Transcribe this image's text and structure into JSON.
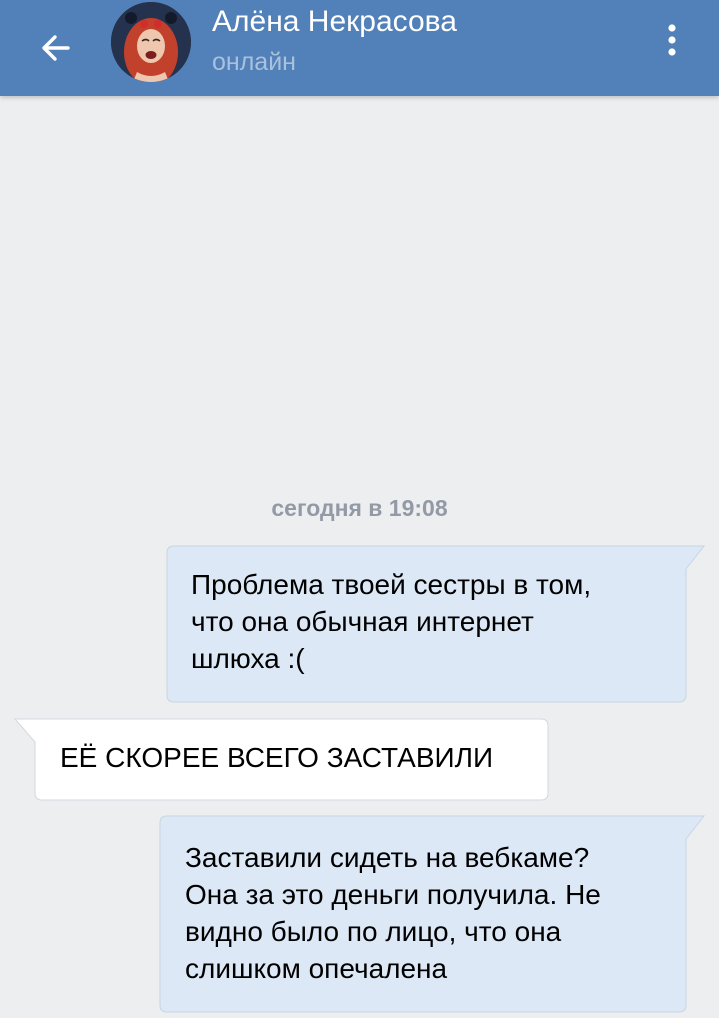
{
  "header": {
    "title": "Алёна Некрасова",
    "status": "онлайн",
    "back_icon": "arrow-left-icon",
    "menu_icon": "more-vertical-icon",
    "background_color": "#5181b8"
  },
  "chat": {
    "date_separator": "сегодня в 19:08",
    "outgoing_bubble_color": "#dce8f6",
    "incoming_bubble_color": "#ffffff",
    "messages": [
      {
        "direction": "outgoing",
        "lines": [
          "Проблема твоей сестры в том,",
          "что она обычная интернет",
          "шлюха :("
        ]
      },
      {
        "direction": "incoming",
        "lines": [
          "ЕЁ СКОРЕЕ ВСЕГО ЗАСТАВИЛИ"
        ]
      },
      {
        "direction": "outgoing",
        "lines": [
          "Заставили сидеть на вебкаме?",
          "Она за это деньги получила. Не",
          "видно было по лицо, что она",
          "слишком опечалена"
        ]
      }
    ]
  }
}
